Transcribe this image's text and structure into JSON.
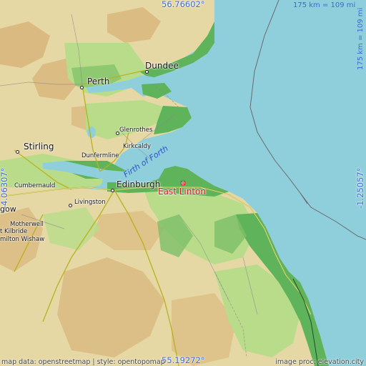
{
  "map": {
    "place": "East Linton",
    "coords": {
      "top": "56.76602°",
      "bottom": "55.19272°",
      "left": "-4.06307°",
      "right": "-1.25057°"
    },
    "scale": {
      "horizontal": "175 km = 109 mi",
      "vertical": "175 km = 109 mi"
    },
    "labels": {
      "dundee": "Dundee",
      "perth": "Perth",
      "glenrothes": "Glenrothes",
      "kirkcaldy": "Kirkcaldy",
      "stirling": "Stirling",
      "dunfermline": "Dunfermline",
      "firth": "Firth of Forth",
      "edinburgh": "Edinburgh",
      "cumbernauld": "Cumbernauld",
      "livingston": "Livingston",
      "glasgow": "gow",
      "motherwell": "Motherwell",
      "east_kilbride": "t Kilbride",
      "hamilton_wishaw": "milton Wishaw"
    },
    "credits": {
      "left": "map data: openstreetmap | style: opentopomap",
      "right": "image proc: elevation.city"
    },
    "colors": {
      "sea": "#8fcfdc",
      "lowland": "#5fb35a",
      "plain": "#b8dc8a",
      "upland": "#e9dcae",
      "highland": "#d8b77c",
      "highlight": "#d4151c",
      "coord_text": "#3c6ad0"
    }
  }
}
